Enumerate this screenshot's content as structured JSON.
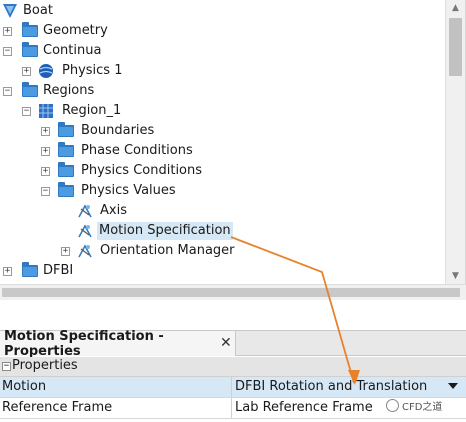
{
  "tree": {
    "items": [
      {
        "label": "Boat",
        "icon": "sim-root-icon"
      },
      {
        "label": "Geometry",
        "icon": "folder-icon"
      },
      {
        "label": "Continua",
        "icon": "folder-icon"
      },
      {
        "label": "Physics 1",
        "icon": "physics-continuum-icon"
      },
      {
        "label": "Regions",
        "icon": "folder-icon"
      },
      {
        "label": "Region_1",
        "icon": "region-icon"
      },
      {
        "label": "Boundaries",
        "icon": "folder-icon"
      },
      {
        "label": "Phase Conditions",
        "icon": "folder-icon"
      },
      {
        "label": "Physics Conditions",
        "icon": "folder-icon"
      },
      {
        "label": "Physics Values",
        "icon": "folder-icon"
      },
      {
        "label": "Axis",
        "icon": "physics-value-icon"
      },
      {
        "label": "Motion Specification",
        "icon": "physics-value-icon"
      },
      {
        "label": "Orientation Manager",
        "icon": "physics-value-icon"
      },
      {
        "label": "DFBI",
        "icon": "folder-icon"
      }
    ]
  },
  "properties": {
    "tab_title": "Motion Specification - Properties",
    "close_symbol": "✕",
    "section_label": "Properties",
    "section_toggle": "−",
    "rows": [
      {
        "name": "Motion",
        "value": "DFBI Rotation and Translation"
      },
      {
        "name": "Reference Frame",
        "value": "Lab Reference Frame"
      }
    ]
  },
  "watermark": {
    "text": "CFD之道"
  },
  "colors": {
    "selection": "#d6e8f5",
    "folder": "#2f78c4",
    "annotation_arrow": "#e8822a"
  }
}
